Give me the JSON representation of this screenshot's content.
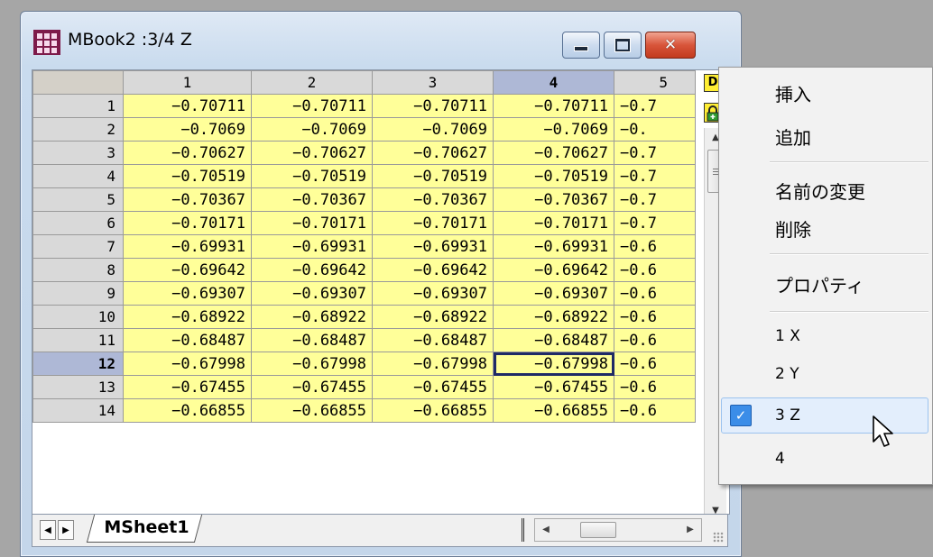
{
  "window": {
    "title": "MBook2 :3/4 Z"
  },
  "grid": {
    "columns": [
      "1",
      "2",
      "3",
      "4",
      "5"
    ],
    "selected_column": "4",
    "selected_row": "12",
    "rows": [
      {
        "label": "1",
        "cells": [
          "−0.70711",
          "−0.70711",
          "−0.70711",
          "−0.70711",
          "−0.7"
        ]
      },
      {
        "label": "2",
        "cells": [
          "−0.7069",
          "−0.7069",
          "−0.7069",
          "−0.7069",
          "−0."
        ]
      },
      {
        "label": "3",
        "cells": [
          "−0.70627",
          "−0.70627",
          "−0.70627",
          "−0.70627",
          "−0.7"
        ]
      },
      {
        "label": "4",
        "cells": [
          "−0.70519",
          "−0.70519",
          "−0.70519",
          "−0.70519",
          "−0.7"
        ]
      },
      {
        "label": "5",
        "cells": [
          "−0.70367",
          "−0.70367",
          "−0.70367",
          "−0.70367",
          "−0.7"
        ]
      },
      {
        "label": "6",
        "cells": [
          "−0.70171",
          "−0.70171",
          "−0.70171",
          "−0.70171",
          "−0.7"
        ]
      },
      {
        "label": "7",
        "cells": [
          "−0.69931",
          "−0.69931",
          "−0.69931",
          "−0.69931",
          "−0.6"
        ]
      },
      {
        "label": "8",
        "cells": [
          "−0.69642",
          "−0.69642",
          "−0.69642",
          "−0.69642",
          "−0.6"
        ]
      },
      {
        "label": "9",
        "cells": [
          "−0.69307",
          "−0.69307",
          "−0.69307",
          "−0.69307",
          "−0.6"
        ]
      },
      {
        "label": "10",
        "cells": [
          "−0.68922",
          "−0.68922",
          "−0.68922",
          "−0.68922",
          "−0.6"
        ]
      },
      {
        "label": "11",
        "cells": [
          "−0.68487",
          "−0.68487",
          "−0.68487",
          "−0.68487",
          "−0.6"
        ]
      },
      {
        "label": "12",
        "cells": [
          "−0.67998",
          "−0.67998",
          "−0.67998",
          "−0.67998",
          "−0.6"
        ]
      },
      {
        "label": "13",
        "cells": [
          "−0.67455",
          "−0.67455",
          "−0.67455",
          "−0.67455",
          "−0.6"
        ]
      },
      {
        "label": "14",
        "cells": [
          "−0.66855",
          "−0.66855",
          "−0.66855",
          "−0.66855",
          "−0.6"
        ]
      }
    ],
    "cell_color": "#ffff99",
    "d_icon_label": "D"
  },
  "sheet_tab": {
    "label": "MSheet1"
  },
  "context_menu": {
    "items": {
      "insert": "挿入",
      "append": "追加",
      "rename": "名前の変更",
      "delete": "削除",
      "properties": "プロパティ",
      "layer_1": "1 X",
      "layer_2": "2 Y",
      "layer_3": "3 Z",
      "layer_4": "4"
    },
    "checked_item": "3 Z",
    "highlight_color": "#e3eefc",
    "check_color": "#3b8de8"
  }
}
